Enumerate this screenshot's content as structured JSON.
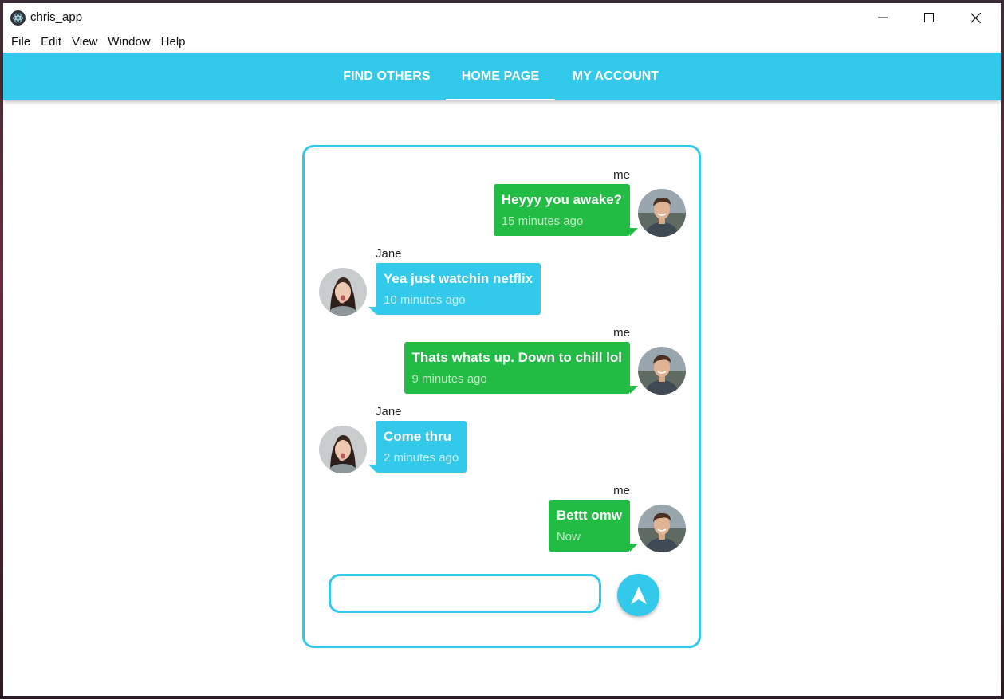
{
  "window": {
    "title": "chris_app",
    "controls": {
      "minimize": "minimize",
      "maximize": "maximize",
      "close": "close"
    }
  },
  "menu": [
    "File",
    "Edit",
    "View",
    "Window",
    "Help"
  ],
  "tabs": [
    {
      "label": "FIND OTHERS",
      "active": false
    },
    {
      "label": "HOME PAGE",
      "active": true
    },
    {
      "label": "MY ACCOUNT",
      "active": false
    }
  ],
  "colors": {
    "accent": "#33c9ea",
    "me_bubble": "#22bb44",
    "jane_bubble": "#33c9ea"
  },
  "messages": [
    {
      "sender": "me",
      "text": "Heyyy you awake?",
      "time": "15 minutes ago"
    },
    {
      "sender": "Jane",
      "text": "Yea just watchin netflix",
      "time": "10 minutes ago"
    },
    {
      "sender": "me",
      "text": "Thats whats up. Down to chill lol",
      "time": "9 minutes ago"
    },
    {
      "sender": "Jane",
      "text": "Come thru",
      "time": "2 minutes ago"
    },
    {
      "sender": "me",
      "text": "Bettt omw",
      "time": "Now"
    }
  ],
  "composer": {
    "value": "",
    "placeholder": "",
    "send_icon": "send-arrow-icon"
  }
}
